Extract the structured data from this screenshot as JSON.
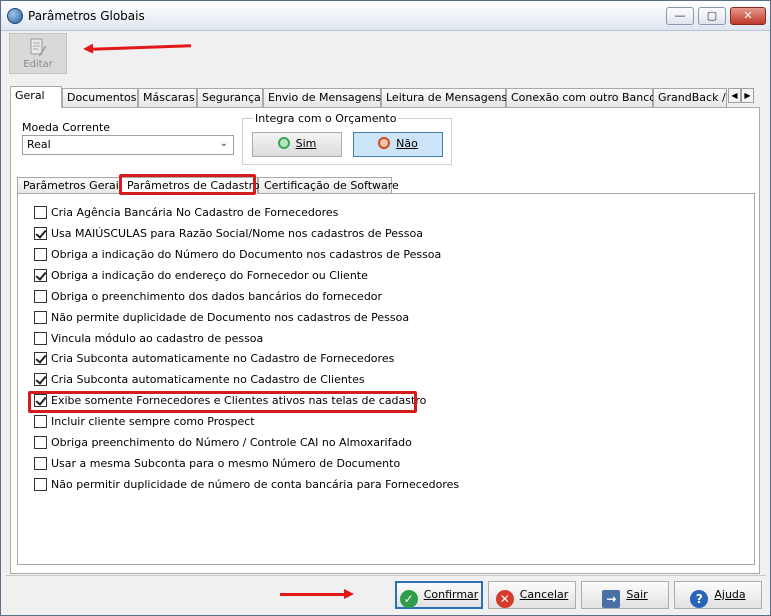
{
  "window": {
    "title": "Parâmetros Globais",
    "min_glyph": "—",
    "max_glyph": "▢",
    "close_glyph": "✕"
  },
  "toolbar": {
    "edit_label": "Editar",
    "edit_icon": "edit-document-icon"
  },
  "top_tabs": [
    "Geral",
    "Documentos",
    "Máscaras",
    "Segurança",
    "Envio de Mensagens",
    "Leitura de Mensagens",
    "Conexão com outro Banco",
    "GrandBack / I"
  ],
  "top_tabs_scroll": {
    "left": "◀",
    "right": "▶"
  },
  "currency": {
    "label": "Moeda Corrente",
    "value": "Real",
    "chevron": "⌄"
  },
  "budget_integration": {
    "legend": "Integra com o Orçamento",
    "yes_label": "Sim",
    "no_label": "Não",
    "selected": "Não"
  },
  "inner_tabs": [
    "Parâmetros Gerais",
    "Parâmetros de Cadastro",
    "Certificação de Software"
  ],
  "inner_active": "Parâmetros de Cadastro",
  "options": [
    {
      "label": "Cria Agência Bancária No Cadastro de Fornecedores",
      "checked": false
    },
    {
      "label": "Usa MAIÚSCULAS para Razão Social/Nome nos cadastros de Pessoa",
      "checked": true
    },
    {
      "label": "Obriga a indicação do Número do Documento nos cadastros de Pessoa",
      "checked": false
    },
    {
      "label": "Obriga a indicação do endereço do Fornecedor ou Cliente",
      "checked": true
    },
    {
      "label": "Obriga o preenchimento dos dados bancários do fornecedor",
      "checked": false
    },
    {
      "label": "Não permite duplicidade de Documento nos cadastros de Pessoa",
      "checked": false
    },
    {
      "label": "Vincula módulo ao cadastro de pessoa",
      "checked": false
    },
    {
      "label": "Cria Subconta automaticamente no Cadastro de Fornecedores",
      "checked": true
    },
    {
      "label": "Cria Subconta automaticamente no Cadastro de Clientes",
      "checked": true
    },
    {
      "label": "Exibe somente Fornecedores e Clientes ativos nas telas de cadastro",
      "checked": true
    },
    {
      "label": "Incluir cliente sempre como Prospect",
      "checked": false
    },
    {
      "label": "Obriga preenchimento do Número / Controle CAI no Almoxarifado",
      "checked": false
    },
    {
      "label": "Usar a mesma Subconta para o mesmo Número de Documento",
      "checked": false
    },
    {
      "label": "Não permitir duplicidade de número de conta bancária para Fornecedores",
      "checked": false
    }
  ],
  "footer": {
    "confirm": "Confirmar",
    "cancel": "Cancelar",
    "exit": "Sair",
    "help": "Ajuda",
    "icons": {
      "ok": "✓",
      "cancel": "✕",
      "exit": "→",
      "help": "?"
    }
  },
  "colors": {
    "highlight": "#d51c1c",
    "selected_button": "#cce4f7",
    "title_bar": "#dfe6f0"
  }
}
